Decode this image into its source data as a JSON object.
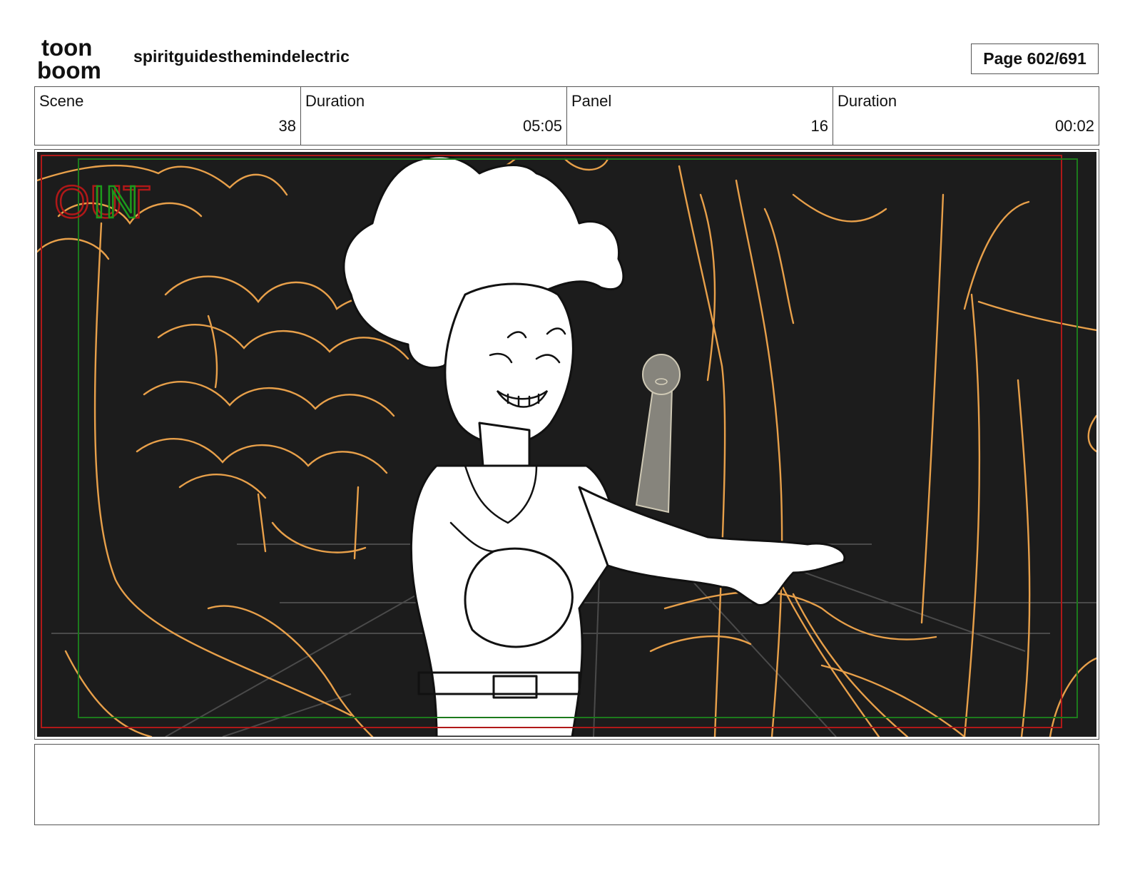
{
  "header": {
    "logo_text_top": "toon",
    "logo_text_bottom": "boom",
    "project_title": "spiritguidesthemindelectric",
    "page_label": "Page 602/691"
  },
  "info": {
    "scene_label": "Scene",
    "scene_value": "38",
    "scene_duration_label": "Duration",
    "scene_duration_value": "05:05",
    "panel_label": "Panel",
    "panel_value": "16",
    "panel_duration_label": "Duration",
    "panel_duration_value": "00:02"
  },
  "panel": {
    "overlay_out": "OUT",
    "overlay_in": "IN",
    "colors": {
      "background": "#1c1c1c",
      "sketch_orange": "#e8a04a",
      "character_fill": "#ffffff",
      "spirit_fill": "#86847c",
      "out_frame": "#b01818",
      "in_frame": "#1c7a1c"
    }
  },
  "notes": {
    "text": ""
  }
}
